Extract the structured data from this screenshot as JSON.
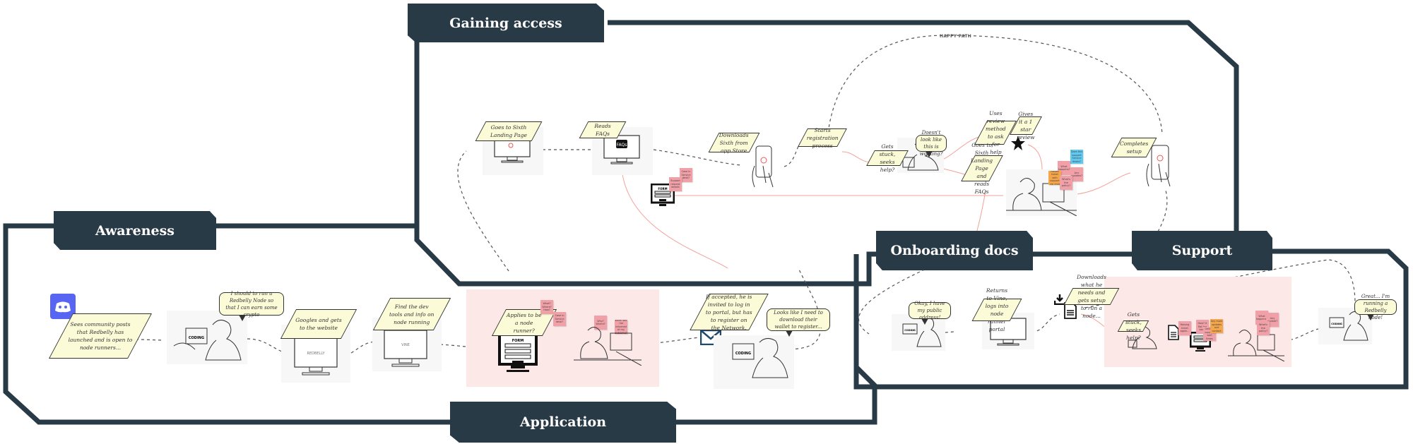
{
  "colors": {
    "frame": "#293a47",
    "note": "#fbfbd7",
    "zone": "#fde8e8",
    "sticky_pink": "#f2a0a8",
    "sticky_orange": "#f5a54a",
    "sticky_blue": "#5fc9ef",
    "discord": "#5865f2",
    "flow_line": "#f08a80"
  },
  "stages": {
    "awareness": "Awareness",
    "gaining_access": "Gaining access",
    "application": "Application",
    "onboarding_docs": "Onboarding docs",
    "support": "Support"
  },
  "happy_path_label": "HAPPY PATH",
  "awareness": {
    "discord_icon": "discord-icon",
    "notes": [
      "Sees community posts that Redbelly has launched and is open to node runners...",
      "Googles and gets to the website",
      "Find the dev tools and info on node running"
    ],
    "bubble": "I should to run a Redbelly Node so that I can earn some crypto",
    "screen_labels": [
      "CODING",
      "REDBELLY",
      "VINE"
    ]
  },
  "application": {
    "notes": [
      "Applies to be a node runner?",
      "If accepted, he is invited to log in to portal, but has to register on the Network."
    ],
    "bubble": "Looks like I need to download their wallet to register...",
    "form_label": "FORM",
    "stickies": [
      "What? Where? How?",
      "Case in Service desk?",
      "Why? Where?",
      "When will I be informed of my outcome?"
    ],
    "screen_label": "CODING"
  },
  "gaining_access": {
    "notes": [
      "Goes to Sixth Landing Page",
      "Reads FAQs",
      "Downloads Sixth from app Store",
      "Starts registration process",
      "Gets stuck, seeks help?",
      "Uses review method to ask for help",
      "Gives it a 1 star review",
      "Goes to Sixth Landing Page and reads FAQs",
      "Completes setup"
    ],
    "bubble": "Doesn't look like this is working?",
    "faq_label": "FAQs",
    "form_label": "FORM",
    "stickies": [
      "Case in Service desk?",
      "Support request details",
      "Does this support Service desks?",
      "What happens?",
      "Any updates?",
      "Raises ticket with support via chat",
      "What's the policy?"
    ]
  },
  "onboarding": {
    "bubble": "Okay, I have my public address!",
    "notes": [
      "Returns to Vine, logs into node runner portal",
      "Downloads what he needs and gets setup to run a node..."
    ],
    "screen_label": "CODING"
  },
  "support": {
    "notes": [
      "Gets stuck, seeks help?"
    ],
    "stickies": [
      "Raising ticket again...",
      "How? It flat too basic",
      "Getting support wait times",
      "Any more updates and contact",
      "What happens?",
      "Any update?",
      "What's the policy?"
    ],
    "bubble": "Great... I'm running a Redbelly node!",
    "screen_label": "CODING"
  }
}
